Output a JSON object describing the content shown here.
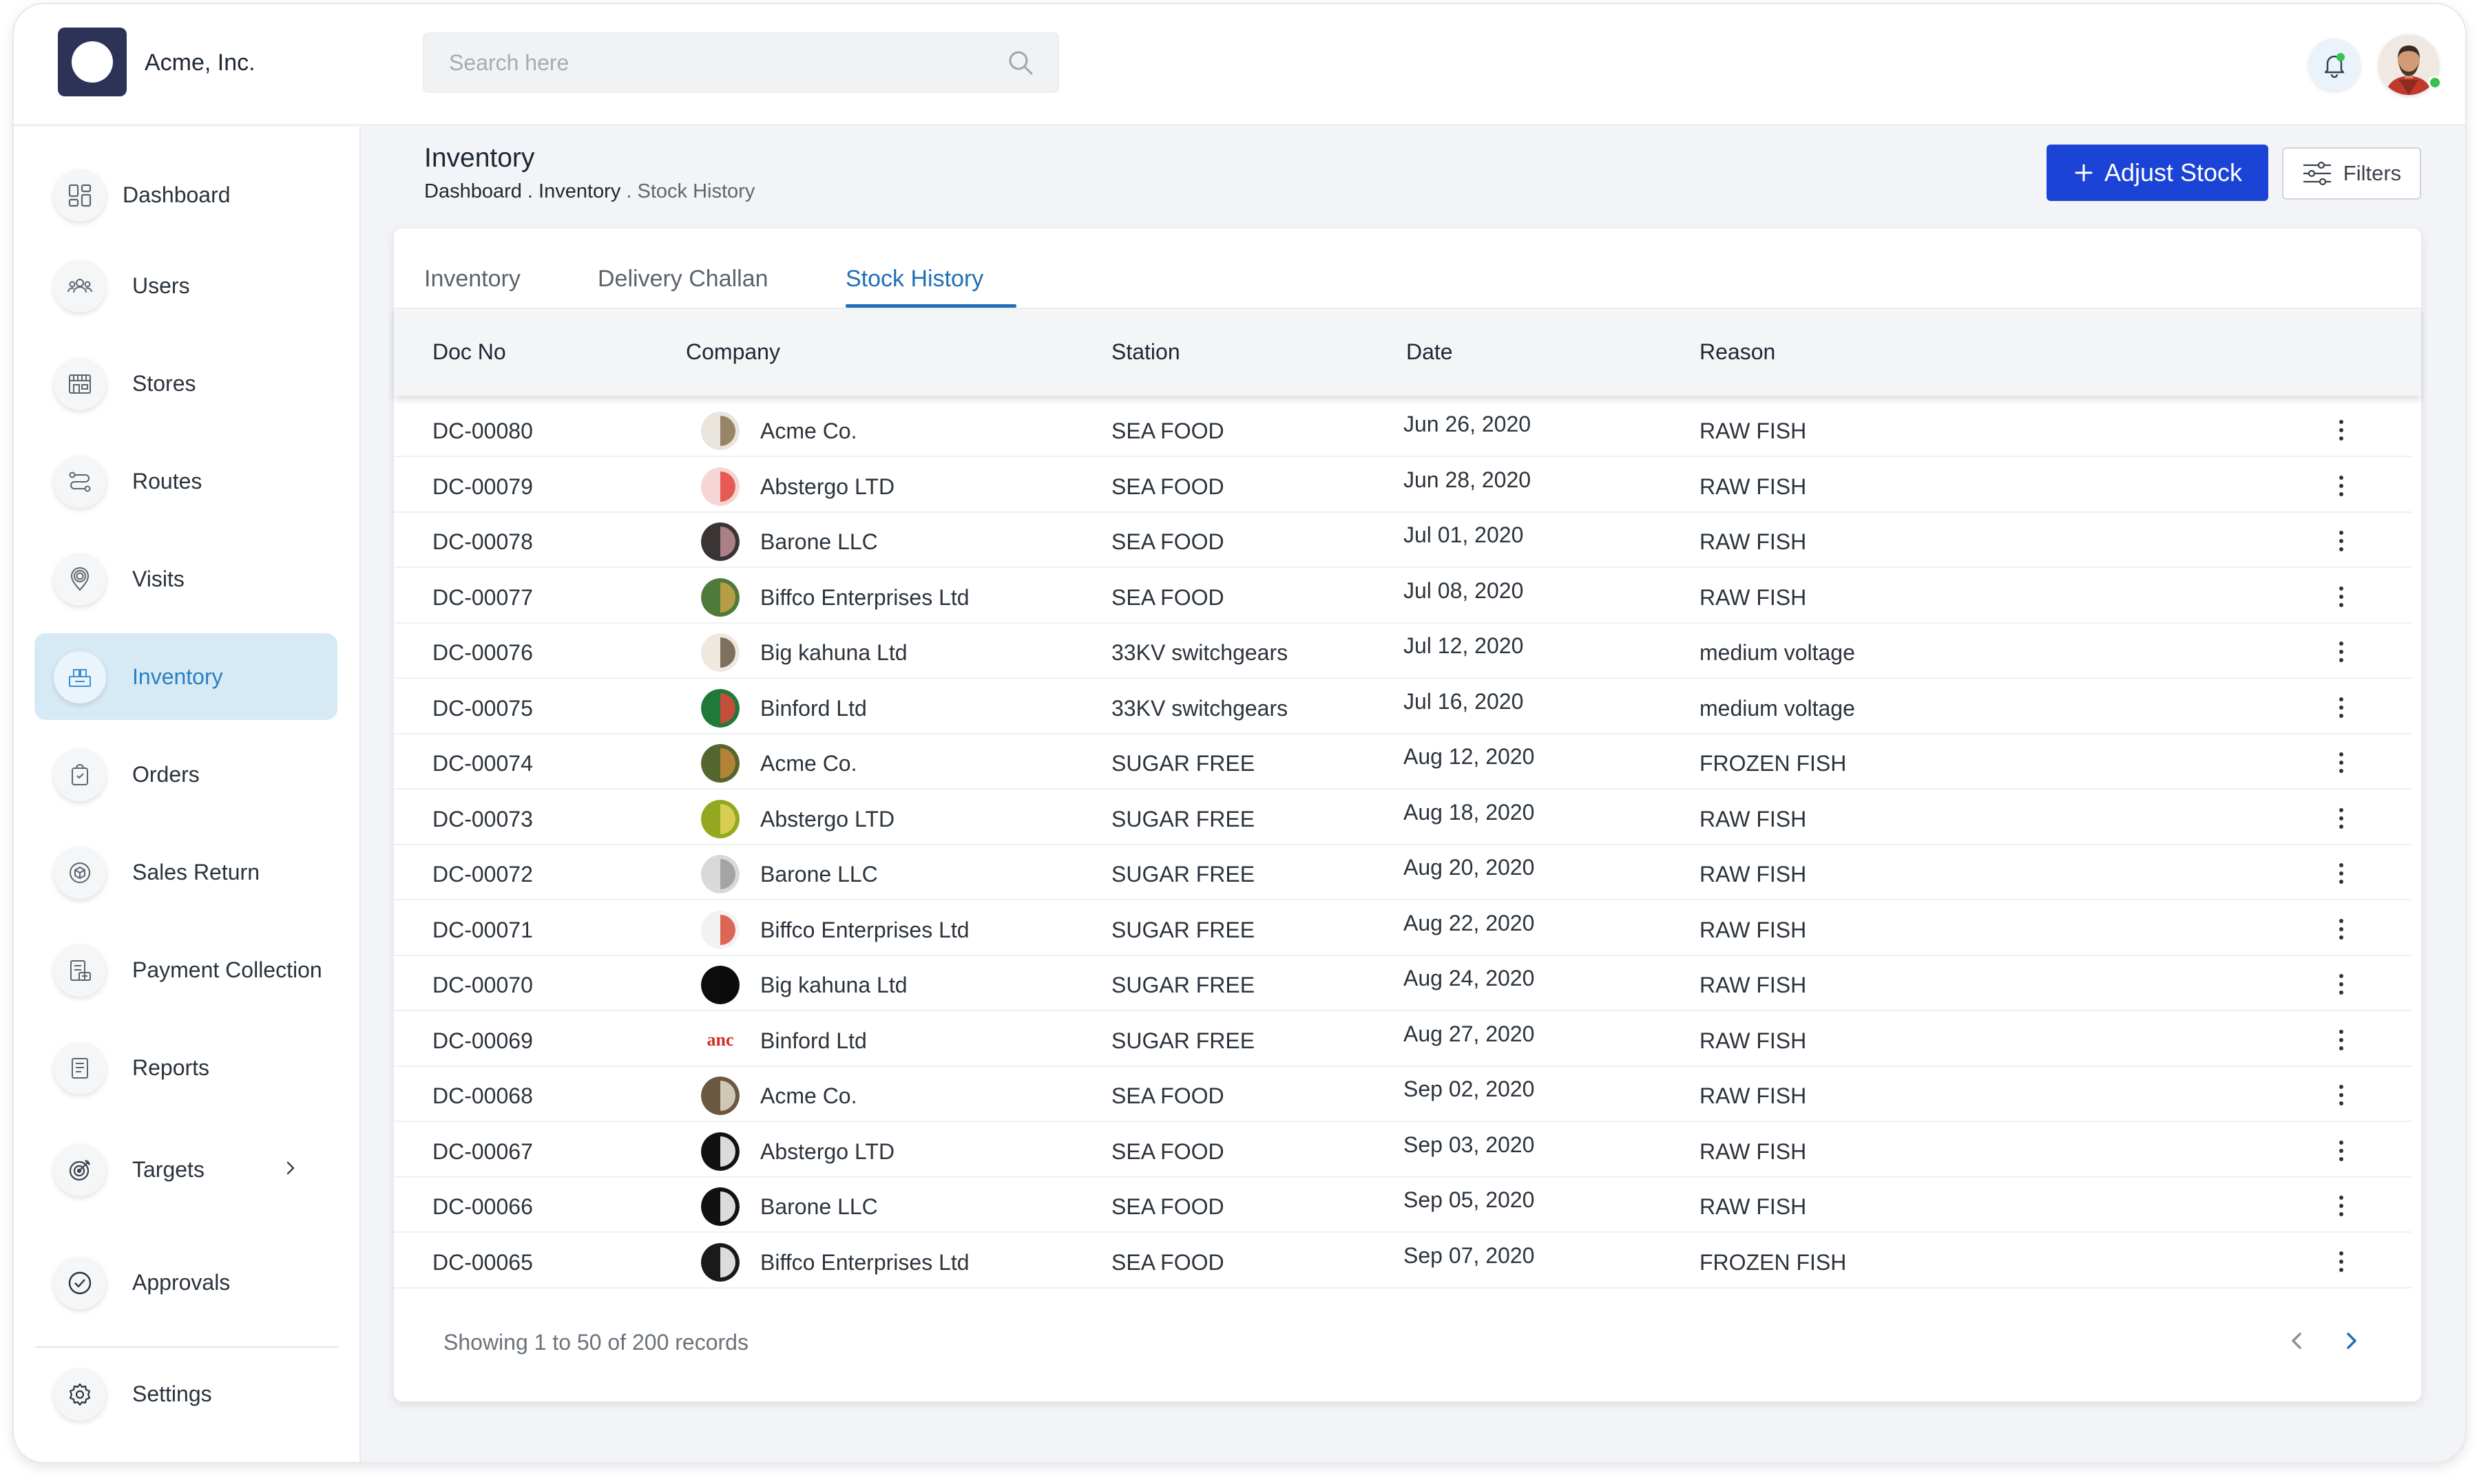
{
  "app": {
    "company": "Acme, Inc.",
    "search_placeholder": "Search here"
  },
  "sidebar": {
    "items": [
      {
        "label": "Dashboard",
        "icon": "dashboard-icon"
      },
      {
        "label": "Users",
        "icon": "users-icon"
      },
      {
        "label": "Stores",
        "icon": "store-icon"
      },
      {
        "label": "Routes",
        "icon": "route-icon"
      },
      {
        "label": "Visits",
        "icon": "location-pin-icon"
      },
      {
        "label": "Inventory",
        "icon": "inventory-icon",
        "active": true
      },
      {
        "label": "Orders",
        "icon": "orders-icon"
      },
      {
        "label": "Sales Return",
        "icon": "sales-return-icon"
      },
      {
        "label": "Payment Collection",
        "icon": "payment-collection-icon"
      },
      {
        "label": "Reports",
        "icon": "reports-icon"
      },
      {
        "label": "Targets",
        "icon": "target-icon"
      },
      {
        "label": "Approvals",
        "icon": "check-circle-icon"
      },
      {
        "label": "Settings",
        "icon": "gear-icon"
      }
    ]
  },
  "header": {
    "title": "Inventory",
    "breadcrumb": {
      "part1": "Dashboard",
      "sep1": " . ",
      "part2": "Inventory",
      "sep2": " . ",
      "part3": "Stock History"
    },
    "adjust_label": "Adjust Stock",
    "filters_label": "Filters"
  },
  "tabs": [
    {
      "label": "Inventory"
    },
    {
      "label": "Delivery Challan"
    },
    {
      "label": "Stock History",
      "active": true
    }
  ],
  "table": {
    "columns": [
      "Doc No",
      "Company",
      "Station",
      "Date",
      "Reason"
    ],
    "rows": [
      {
        "doc": "DC-00080",
        "company": "Acme Co.",
        "station": "SEA FOOD",
        "date": "Jun 26, 2020",
        "reason": "RAW FISH"
      },
      {
        "doc": "DC-00079",
        "company": "Abstergo LTD",
        "station": "SEA FOOD",
        "date": "Jun 28, 2020",
        "reason": "RAW FISH"
      },
      {
        "doc": "DC-00078",
        "company": "Barone LLC",
        "station": "SEA FOOD",
        "date": "Jul 01, 2020",
        "reason": "RAW FISH"
      },
      {
        "doc": "DC-00077",
        "company": "Biffco Enterprises Ltd",
        "station": "SEA FOOD",
        "date": "Jul 08, 2020",
        "reason": "RAW FISH"
      },
      {
        "doc": "DC-00076",
        "company": "Big kahuna Ltd",
        "station": "33KV switchgears",
        "date": "Jul 12, 2020",
        "reason": "medium voltage"
      },
      {
        "doc": "DC-00075",
        "company": "Binford Ltd",
        "station": "33KV switchgears",
        "date": "Jul 16, 2020",
        "reason": "medium voltage"
      },
      {
        "doc": "DC-00074",
        "company": "Acme Co.",
        "station": "SUGAR FREE",
        "date": "Aug 12, 2020",
        "reason": "FROZEN FISH"
      },
      {
        "doc": "DC-00073",
        "company": "Abstergo LTD",
        "station": "SUGAR FREE",
        "date": "Aug 18, 2020",
        "reason": "RAW FISH"
      },
      {
        "doc": "DC-00072",
        "company": "Barone LLC",
        "station": "SUGAR FREE",
        "date": "Aug 20, 2020",
        "reason": "RAW FISH"
      },
      {
        "doc": "DC-00071",
        "company": "Biffco Enterprises Ltd",
        "station": "SUGAR FREE",
        "date": "Aug 22, 2020",
        "reason": "RAW FISH"
      },
      {
        "doc": "DC-00070",
        "company": "Big kahuna Ltd",
        "station": "SUGAR FREE",
        "date": "Aug 24, 2020",
        "reason": "RAW FISH"
      },
      {
        "doc": "DC-00069",
        "company": "Binford Ltd",
        "station": "SUGAR FREE",
        "date": "Aug 27, 2020",
        "reason": "RAW FISH"
      },
      {
        "doc": "DC-00068",
        "company": "Acme Co.",
        "station": "SEA FOOD",
        "date": "Sep 02, 2020",
        "reason": "RAW FISH"
      },
      {
        "doc": "DC-00067",
        "company": "Abstergo LTD",
        "station": "SEA FOOD",
        "date": "Sep 03, 2020",
        "reason": "RAW FISH"
      },
      {
        "doc": "DC-00066",
        "company": "Barone LLC",
        "station": "SEA FOOD",
        "date": "Sep 05, 2020",
        "reason": "RAW FISH"
      },
      {
        "doc": "DC-00065",
        "company": "Biffco Enterprises Ltd",
        "station": "SEA FOOD",
        "date": "Sep 07, 2020",
        "reason": "FROZEN FISH"
      }
    ],
    "logo_text": "anc"
  },
  "pagination": {
    "summary": "Showing 1 to 50 of 200 records"
  },
  "colors": {
    "primary": "#1b44d6",
    "active_tab": "#1f6fb7",
    "sidebar_active_bg": "#d6eaf6",
    "online": "#35c24f"
  }
}
